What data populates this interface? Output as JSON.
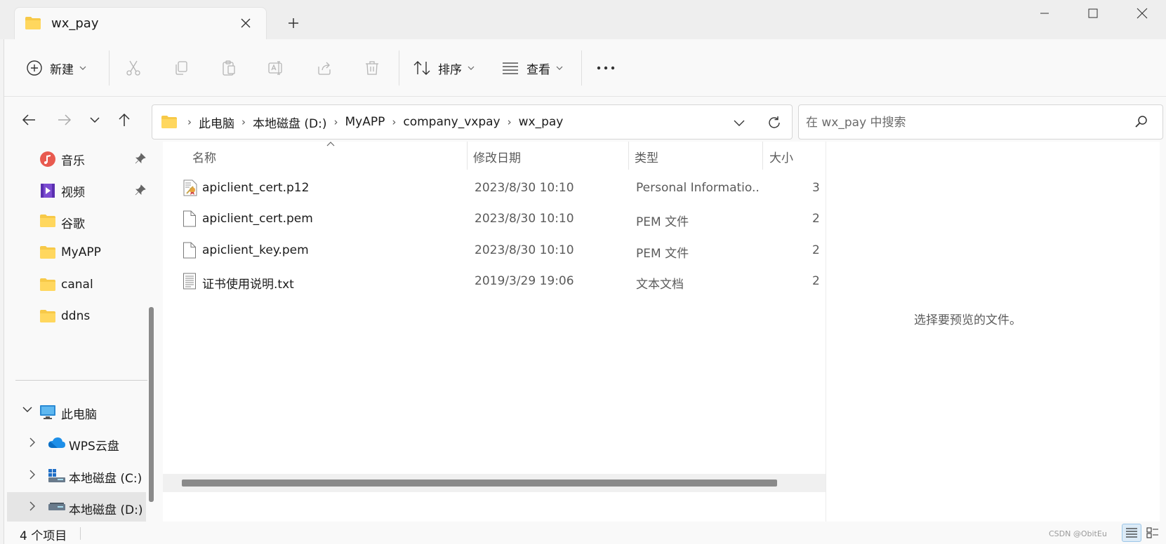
{
  "tab": {
    "title": "wx_pay",
    "close": "×",
    "new_tab": "+"
  },
  "toolbar": {
    "new_label": "新建",
    "sort_label": "排序",
    "view_label": "查看",
    "more": "•••"
  },
  "address": {
    "crumbs": [
      "此电脑",
      "本地磁盘 (D:)",
      "MyAPP",
      "company_vxpay",
      "wx_pay"
    ],
    "separator": "›"
  },
  "search": {
    "placeholder": "在 wx_pay 中搜索"
  },
  "sidebar": {
    "quick": [
      {
        "label": "音乐",
        "icon": "music-icon",
        "pinned": true
      },
      {
        "label": "视频",
        "icon": "video-icon",
        "pinned": true
      },
      {
        "label": "谷歌",
        "icon": "folder-icon"
      },
      {
        "label": "MyAPP",
        "icon": "folder-icon"
      },
      {
        "label": "canal",
        "icon": "folder-icon"
      },
      {
        "label": "ddns",
        "icon": "folder-icon"
      }
    ],
    "tree": [
      {
        "label": "此电脑",
        "icon": "computer-icon",
        "expanded": true
      },
      {
        "label": "WPS云盘",
        "icon": "cloud-icon"
      },
      {
        "label": "本地磁盘 (C:)",
        "icon": "drive-c-icon"
      },
      {
        "label": "本地磁盘 (D:)",
        "icon": "drive-icon",
        "selected": true
      }
    ]
  },
  "columns": {
    "name": "名称",
    "date": "修改日期",
    "type": "类型",
    "size": "大小"
  },
  "files": [
    {
      "name": "apiclient_cert.p12",
      "date": "2023/8/30 10:10",
      "type": "Personal Informatio...",
      "size": "3",
      "icon": "certificate-file-icon"
    },
    {
      "name": "apiclient_cert.pem",
      "date": "2023/8/30 10:10",
      "type": "PEM 文件",
      "size": "2",
      "icon": "file-icon"
    },
    {
      "name": "apiclient_key.pem",
      "date": "2023/8/30 10:10",
      "type": "PEM 文件",
      "size": "2",
      "icon": "file-icon"
    },
    {
      "name": "证书使用说明.txt",
      "date": "2019/3/29 19:06",
      "type": "文本文档",
      "size": "2",
      "icon": "text-file-icon"
    }
  ],
  "preview": {
    "message": "选择要预览的文件。"
  },
  "status": {
    "count": "4 个项目",
    "watermark": "CSDN @ObitEu"
  },
  "colors": {
    "accent": "#0067c0",
    "folder": "#f7c948",
    "status_text": "#1b1b1b"
  }
}
